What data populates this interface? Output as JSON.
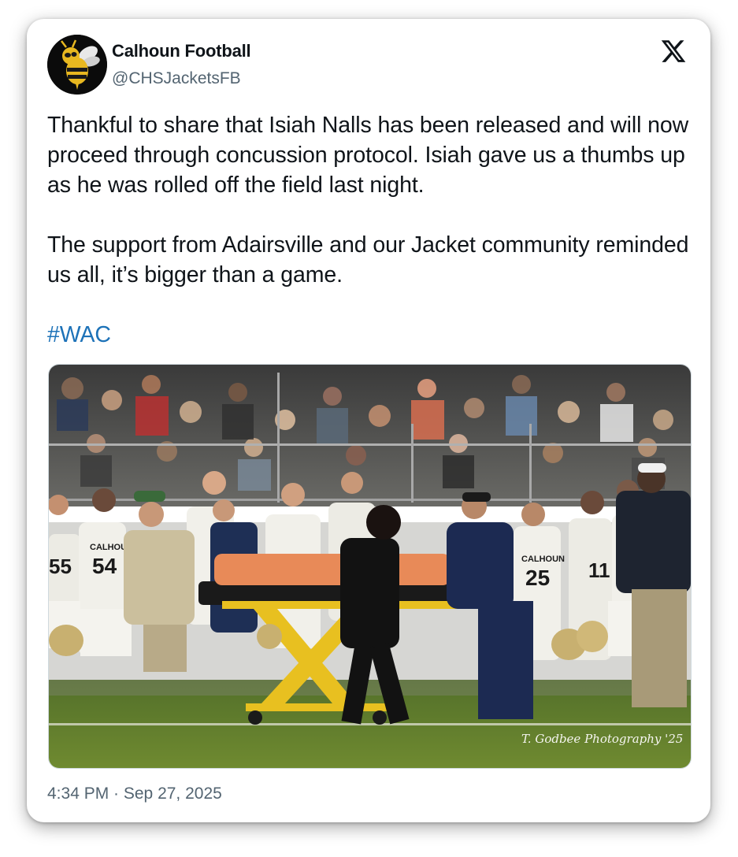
{
  "account": {
    "display_name": "Calhoun Football",
    "handle": "@CHSJacketsFB"
  },
  "tweet": {
    "paragraph1": "Thankful to share that Isiah Nalls has been released and will now proceed through concussion protocol. Isiah gave us a thumbs up as he was rolled off the field last night.",
    "paragraph2": "The support from Adairsville and our Jacket community reminded us all, it’s bigger than a game.",
    "hashtag": "#WAC",
    "timestamp": "4:34 PM · Sep 27, 2025"
  },
  "photo": {
    "watermark": "T. Godbee Photography '25",
    "jersey_texts": [
      "CALHOUN",
      "54",
      "CALHOUN",
      "25",
      "11",
      "55"
    ]
  },
  "colors": {
    "text": "#0f1419",
    "secondary": "#536471",
    "hashtag": "#1d72b8",
    "avatar_bg": "#0b0b0b",
    "turf": "#5f7a2a"
  },
  "icons": {
    "platform": "x-logo-icon",
    "avatar": "yellow-jacket-mascot-icon"
  }
}
